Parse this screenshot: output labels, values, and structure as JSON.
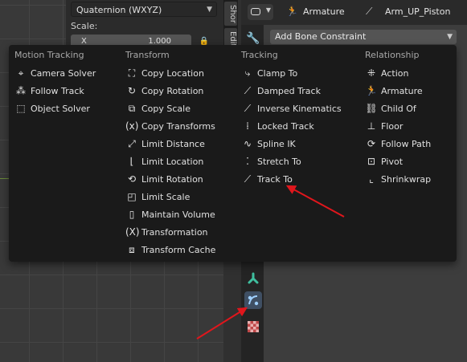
{
  "npanel": {
    "rotation_mode": "Quaternion (WXYZ)",
    "scale_label": "Scale:",
    "scale_x_axis": "X",
    "scale_x_value": "1.000"
  },
  "vtabs": {
    "tab1": "Shor",
    "tab2": "Edit"
  },
  "header": {
    "armature_label": "Armature",
    "bone_label": "Arm_UP_Piston"
  },
  "constraint_dropdown": "Add Bone Constraint",
  "menu": {
    "motion_tracking": {
      "heading": "Motion Tracking",
      "items": [
        {
          "label": "Camera Solver",
          "icon": "camera-solver-icon"
        },
        {
          "label": "Follow Track",
          "icon": "follow-track-icon"
        },
        {
          "label": "Object Solver",
          "icon": "object-solver-icon"
        }
      ]
    },
    "transform": {
      "heading": "Transform",
      "items": [
        {
          "label": "Copy Location",
          "icon": "copy-location-icon"
        },
        {
          "label": "Copy Rotation",
          "icon": "copy-rotation-icon"
        },
        {
          "label": "Copy Scale",
          "icon": "copy-scale-icon"
        },
        {
          "label": "Copy Transforms",
          "icon": "copy-transforms-icon"
        },
        {
          "label": "Limit Distance",
          "icon": "limit-distance-icon"
        },
        {
          "label": "Limit Location",
          "icon": "limit-location-icon"
        },
        {
          "label": "Limit Rotation",
          "icon": "limit-rotation-icon"
        },
        {
          "label": "Limit Scale",
          "icon": "limit-scale-icon"
        },
        {
          "label": "Maintain Volume",
          "icon": "maintain-volume-icon"
        },
        {
          "label": "Transformation",
          "icon": "transformation-icon"
        },
        {
          "label": "Transform Cache",
          "icon": "transform-cache-icon"
        }
      ]
    },
    "tracking": {
      "heading": "Tracking",
      "items": [
        {
          "label": "Clamp To",
          "icon": "clamp-to-icon"
        },
        {
          "label": "Damped Track",
          "icon": "damped-track-icon"
        },
        {
          "label": "Inverse Kinematics",
          "icon": "inverse-kinematics-icon"
        },
        {
          "label": "Locked Track",
          "icon": "locked-track-icon"
        },
        {
          "label": "Spline IK",
          "icon": "spline-ik-icon"
        },
        {
          "label": "Stretch To",
          "icon": "stretch-to-icon"
        },
        {
          "label": "Track To",
          "icon": "track-to-icon"
        }
      ]
    },
    "relationship": {
      "heading": "Relationship",
      "items": [
        {
          "label": "Action",
          "icon": "action-icon"
        },
        {
          "label": "Armature",
          "icon": "armature-icon"
        },
        {
          "label": "Child Of",
          "icon": "child-of-icon"
        },
        {
          "label": "Floor",
          "icon": "floor-icon"
        },
        {
          "label": "Follow Path",
          "icon": "follow-path-icon"
        },
        {
          "label": "Pivot",
          "icon": "pivot-icon"
        },
        {
          "label": "Shrinkwrap",
          "icon": "shrinkwrap-icon"
        }
      ]
    }
  },
  "colors": {
    "annotation_arrow": "#e0161c",
    "active_tab": "#3f4f63",
    "bone_tab": "#3fbf9f",
    "texture_tab": "#c04848"
  }
}
